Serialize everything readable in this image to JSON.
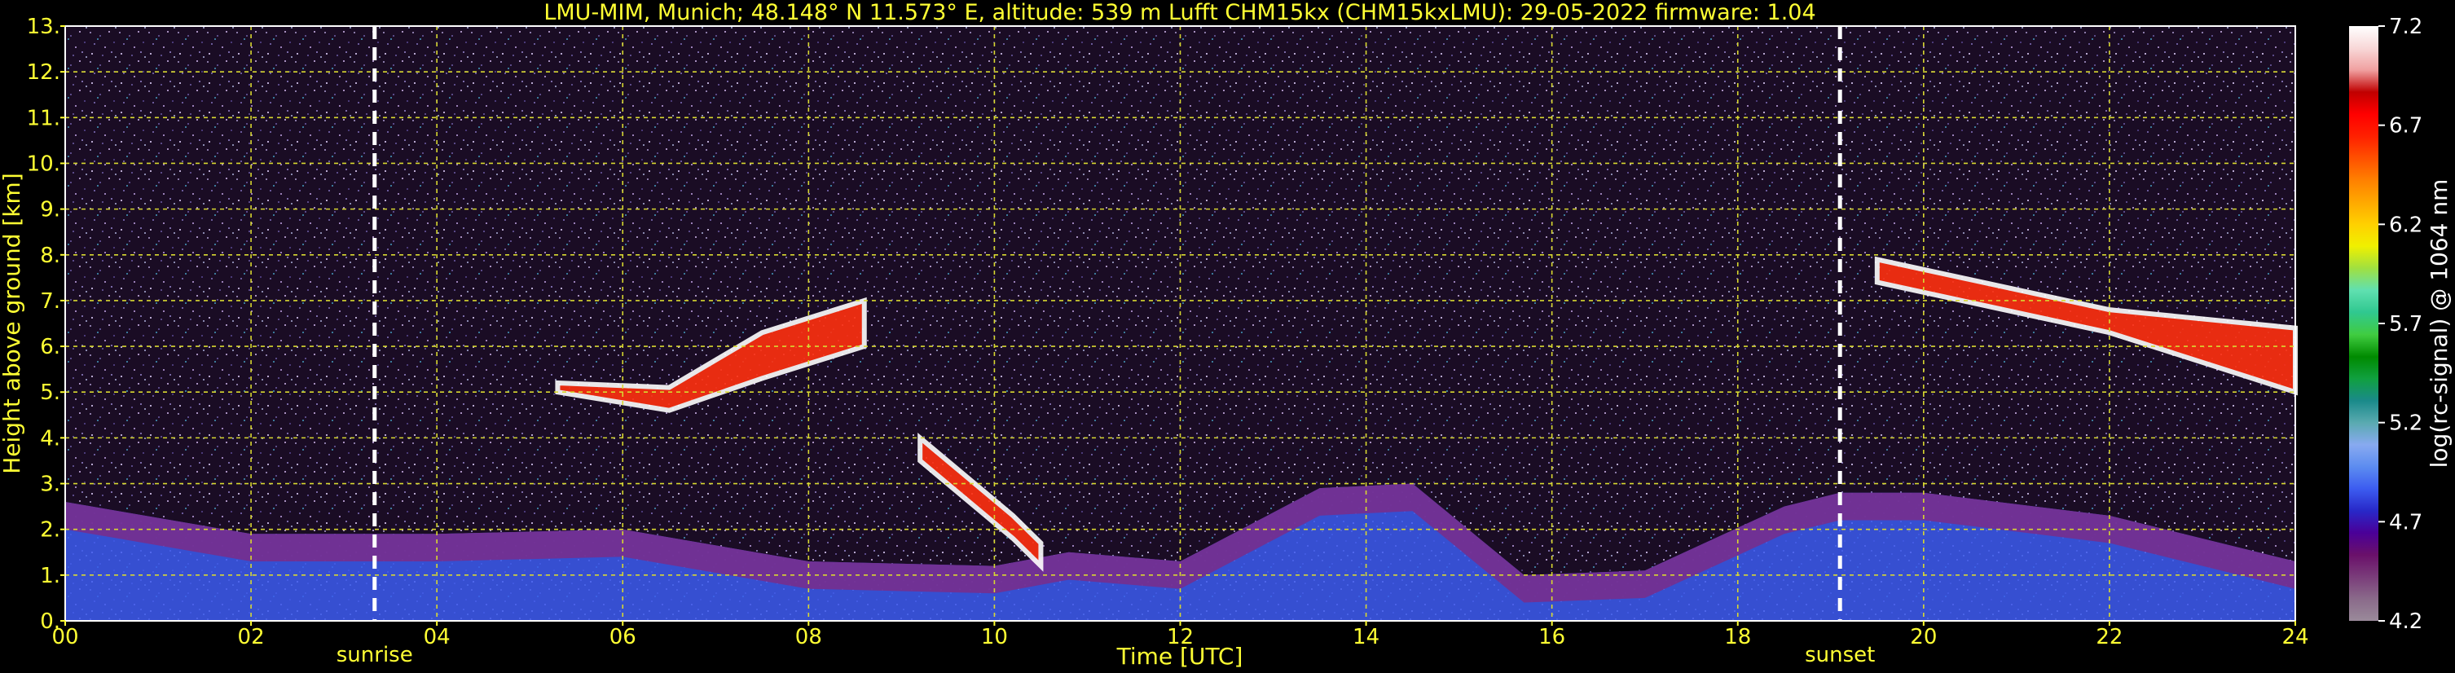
{
  "chart_data": {
    "type": "heatmap",
    "title": "LMU-MIM, Munich; 48.148° N 11.573° E, altitude: 539 m    Lufft CHM15kx (CHM15kxLMU): 29-05-2022    firmware: 1.04",
    "xlabel": "Time [UTC]",
    "ylabel": "Height above ground [km]",
    "xlim": [
      0,
      24
    ],
    "ylim": [
      0,
      13
    ],
    "x_ticks": [
      "00",
      "02",
      "04",
      "06",
      "08",
      "10",
      "12",
      "14",
      "16",
      "18",
      "20",
      "22",
      "24"
    ],
    "y_ticks": [
      "0.",
      "1.",
      "2.",
      "3.",
      "4.",
      "5.",
      "6.",
      "7.",
      "8.",
      "9.",
      "10.",
      "11.",
      "12.",
      "13."
    ],
    "grid": true,
    "colorbar": {
      "label": "log(rc-signal) @ 1064 nm",
      "range": [
        4.2,
        7.2
      ],
      "ticks": [
        "4.2",
        "4.7",
        "5.2",
        "5.7",
        "6.2",
        "6.7",
        "7.2"
      ],
      "colors": [
        "#9a8a9a",
        "#8a6a8a",
        "#7a3c7a",
        "#6a106a",
        "#4a0098",
        "#2828c8",
        "#3c5cf0",
        "#5c8cf0",
        "#88aaf0",
        "#5aaab0",
        "#1a8a8a",
        "#10a040",
        "#008a00",
        "#40cc40",
        "#30c890",
        "#60e0b0",
        "#a0e040",
        "#f0f000",
        "#ffd000",
        "#ffa800",
        "#ff8000",
        "#ff5000",
        "#ff2000",
        "#ff0000",
        "#c00000",
        "#f0a0a0",
        "#f8d8d8",
        "#ffffff"
      ]
    },
    "annotations": [
      {
        "text": "sunrise",
        "x": 3.33
      },
      {
        "text": "sunset",
        "x": 19.1
      }
    ],
    "features": [
      {
        "name": "boundary layer",
        "x": [
          0,
          2,
          4,
          6,
          8,
          10,
          10.8,
          12,
          13.5,
          14.5,
          15.7,
          17,
          18.5,
          19.1,
          20,
          22,
          24
        ],
        "top": [
          2.6,
          1.9,
          1.9,
          2.0,
          1.3,
          1.2,
          1.5,
          1.3,
          2.9,
          3.0,
          1.0,
          1.1,
          2.5,
          2.8,
          2.8,
          2.3,
          1.3
        ]
      },
      {
        "name": "cloud layer",
        "x": [
          5.3,
          6.5,
          7.5,
          8.6
        ],
        "base": [
          5.0,
          4.6,
          5.3,
          6.0
        ],
        "top": [
          5.2,
          5.1,
          6.3,
          7.0
        ]
      },
      {
        "name": "cloud layer",
        "x": [
          9.2,
          10.2,
          10.5
        ],
        "base": [
          3.5,
          1.8,
          1.2
        ],
        "top": [
          4.0,
          2.3,
          1.7
        ]
      },
      {
        "name": "cloud layer",
        "x": [
          19.5,
          22,
          24
        ],
        "base": [
          7.4,
          6.3,
          5.0
        ],
        "top": [
          7.9,
          6.8,
          6.4
        ]
      }
    ]
  }
}
